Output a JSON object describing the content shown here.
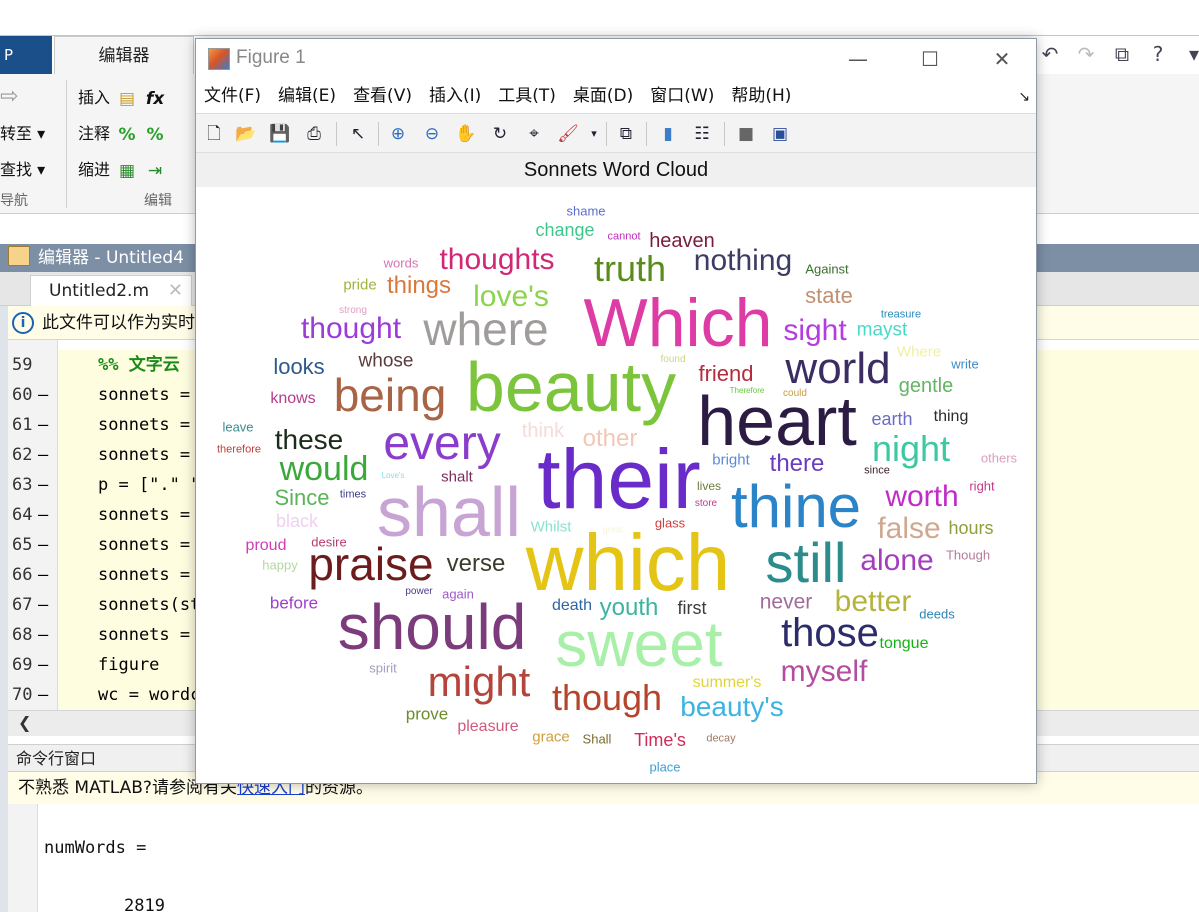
{
  "ribbon": {
    "prev_tab": "P",
    "active_tab": "编辑器",
    "insert": "插入",
    "fx": "fx",
    "goto": "转至",
    "comment": "注释",
    "comment_sym": "%",
    "find": "查找",
    "indent": "缩进",
    "group_nav": "导航",
    "group_edit": "编辑"
  },
  "editor": {
    "title": "编辑器 - Untitled4",
    "tab_label": "Untitled2.m",
    "info": "此文件可以作为实时",
    "lines": [
      {
        "num": "59",
        "dash": "",
        "text": "%% 文字云",
        "cell": true
      },
      {
        "num": "60",
        "dash": "—",
        "text": "sonnets =",
        "cell": false
      },
      {
        "num": "61",
        "dash": "—",
        "text": "sonnets =",
        "cell": false
      },
      {
        "num": "62",
        "dash": "—",
        "text": "sonnets =",
        "cell": false
      },
      {
        "num": "63",
        "dash": "—",
        "text": "p = [\".\" \"",
        "cell": false
      },
      {
        "num": "64",
        "dash": "—",
        "text": "sonnets =",
        "cell": false
      },
      {
        "num": "65",
        "dash": "—",
        "text": "sonnets =",
        "cell": false
      },
      {
        "num": "66",
        "dash": "—",
        "text": "sonnets =",
        "cell": false
      },
      {
        "num": "67",
        "dash": "—",
        "text": "sonnets(st",
        "cell": false
      },
      {
        "num": "68",
        "dash": "—",
        "text": "sonnets =",
        "cell": false
      },
      {
        "num": "69",
        "dash": "—",
        "text": "figure",
        "cell": false
      },
      {
        "num": "70",
        "dash": "—",
        "text": "wc = wordc",
        "cell": false
      }
    ]
  },
  "command": {
    "title": "命令行窗口",
    "info_prefix": "不熟悉 MATLAB?请参阅有关",
    "info_link": "快速入门",
    "info_suffix": "的资源。",
    "out_var": "numWords =",
    "out_val": "2819"
  },
  "figure": {
    "title": "Figure 1",
    "menus": [
      "文件(F)",
      "编辑(E)",
      "查看(V)",
      "插入(I)",
      "工具(T)",
      "桌面(D)",
      "窗口(W)",
      "帮助(H)"
    ],
    "chart_title": "Sonnets Word Cloud"
  },
  "chart_data": {
    "type": "wordcloud",
    "title": "Sonnets Word Cloud",
    "words": [
      {
        "text": "shame",
        "color": "#5a6fd0",
        "size": 13
      },
      {
        "text": "change",
        "color": "#3cc88c",
        "size": 18
      },
      {
        "text": "cannot",
        "color": "#c030c0",
        "size": 11
      },
      {
        "text": "heaven",
        "color": "#7a1c3c",
        "size": 20
      },
      {
        "text": "words",
        "color": "#d873b0",
        "size": 13
      },
      {
        "text": "thoughts",
        "color": "#d02874",
        "size": 30
      },
      {
        "text": "truth",
        "color": "#5a8c1c",
        "size": 36
      },
      {
        "text": "nothing",
        "color": "#3c3c64",
        "size": 30
      },
      {
        "text": "Against",
        "color": "#3a6e2e",
        "size": 13
      },
      {
        "text": "pride",
        "color": "#a0b43c",
        "size": 15
      },
      {
        "text": "things",
        "color": "#d8783c",
        "size": 24
      },
      {
        "text": "love's",
        "color": "#8cd44c",
        "size": 30
      },
      {
        "text": "state",
        "color": "#c09070",
        "size": 22
      },
      {
        "text": "strong",
        "color": "#e0a0c0",
        "size": 10
      },
      {
        "text": "treasure",
        "color": "#2c8cc0",
        "size": 11
      },
      {
        "text": "thought",
        "color": "#9c3cd8",
        "size": 30
      },
      {
        "text": "where",
        "color": "#a09c9c",
        "size": 46
      },
      {
        "text": "Which",
        "color": "#dc3ca4",
        "size": 68
      },
      {
        "text": "sight",
        "color": "#b43ce0",
        "size": 30
      },
      {
        "text": "mayst",
        "color": "#4cd8c8",
        "size": 19
      },
      {
        "text": "looks",
        "color": "#2c5a8c",
        "size": 22
      },
      {
        "text": "whose",
        "color": "#5a3c3c",
        "size": 19
      },
      {
        "text": "found",
        "color": "#c8d880",
        "size": 10
      },
      {
        "text": "Where",
        "color": "#f0f0a0",
        "size": 15
      },
      {
        "text": "write",
        "color": "#3c8cc8",
        "size": 13
      },
      {
        "text": "friend",
        "color": "#b42c3c",
        "size": 22
      },
      {
        "text": "world",
        "color": "#3c2c64",
        "size": 44
      },
      {
        "text": "being",
        "color": "#a86444",
        "size": 46
      },
      {
        "text": "beauty",
        "color": "#7cc43c",
        "size": 70
      },
      {
        "text": "gentle",
        "color": "#64b464",
        "size": 20
      },
      {
        "text": "Therefore",
        "color": "#64c83c",
        "size": 8
      },
      {
        "text": "could",
        "color": "#c89c3c",
        "size": 10
      },
      {
        "text": "knows",
        "color": "#b43c8c",
        "size": 16
      },
      {
        "text": "earth",
        "color": "#6c6cc0",
        "size": 18
      },
      {
        "text": "thing",
        "color": "#2c2c2c",
        "size": 16
      },
      {
        "text": "leave",
        "color": "#3c8c8c",
        "size": 13
      },
      {
        "text": "heart",
        "color": "#2c1c44",
        "size": 70
      },
      {
        "text": "therefore",
        "color": "#c03c3c",
        "size": 11
      },
      {
        "text": "these",
        "color": "#1c2c1c",
        "size": 28
      },
      {
        "text": "every",
        "color": "#8c3ccc",
        "size": 48
      },
      {
        "text": "think",
        "color": "#f4dcd8",
        "size": 20
      },
      {
        "text": "other",
        "color": "#f0c8b4",
        "size": 24
      },
      {
        "text": "night",
        "color": "#3cc8a0",
        "size": 36
      },
      {
        "text": "would",
        "color": "#3ca83c",
        "size": 34
      },
      {
        "text": "their",
        "color": "#6a2cc8",
        "size": 84
      },
      {
        "text": "bright",
        "color": "#5c8cd0",
        "size": 15
      },
      {
        "text": "there",
        "color": "#6c3cc0",
        "size": 24
      },
      {
        "text": "since",
        "color": "#3c1c2c",
        "size": 11
      },
      {
        "text": "others",
        "color": "#d8a0c0",
        "size": 13
      },
      {
        "text": "Love's",
        "color": "#80e0f0",
        "size": 8
      },
      {
        "text": "shalt",
        "color": "#7c2c5c",
        "size": 15
      },
      {
        "text": "lives",
        "color": "#6c7c3c",
        "size": 12
      },
      {
        "text": "right",
        "color": "#c03c8c",
        "size": 13
      },
      {
        "text": "Since",
        "color": "#5ab45a",
        "size": 22
      },
      {
        "text": "times",
        "color": "#3c3c8c",
        "size": 11
      },
      {
        "text": "shall",
        "color": "#c8a4d4",
        "size": 70
      },
      {
        "text": "thine",
        "color": "#2c84c8",
        "size": 60
      },
      {
        "text": "worth",
        "color": "#c02cc8",
        "size": 30
      },
      {
        "text": "store",
        "color": "#c03c8c",
        "size": 10
      },
      {
        "text": "black",
        "color": "#f0d0f0",
        "size": 18
      },
      {
        "text": "Whilst",
        "color": "#8ce0d0",
        "size": 15
      },
      {
        "text": "great",
        "color": "#f4f4e0",
        "size": 9
      },
      {
        "text": "glass",
        "color": "#d03c3c",
        "size": 13
      },
      {
        "text": "false",
        "color": "#d0a890",
        "size": 30
      },
      {
        "text": "hours",
        "color": "#8ca03c",
        "size": 18
      },
      {
        "text": "proud",
        "color": "#d03cb4",
        "size": 16
      },
      {
        "text": "desire",
        "color": "#b43c6c",
        "size": 13
      },
      {
        "text": "praise",
        "color": "#6c1c1c",
        "size": 46
      },
      {
        "text": "verse",
        "color": "#3c3c2c",
        "size": 24
      },
      {
        "text": "which",
        "color": "#e4c414",
        "size": 80
      },
      {
        "text": "still",
        "color": "#2c8c8c",
        "size": 56
      },
      {
        "text": "alone",
        "color": "#a43cc0",
        "size": 30
      },
      {
        "text": "Though",
        "color": "#b47c9c",
        "size": 13
      },
      {
        "text": "happy",
        "color": "#b4d8a0",
        "size": 13
      },
      {
        "text": "power",
        "color": "#4c3c8c",
        "size": 10
      },
      {
        "text": "again",
        "color": "#a05ac8",
        "size": 13
      },
      {
        "text": "before",
        "color": "#a03cd0",
        "size": 17
      },
      {
        "text": "should",
        "color": "#7c3c7c",
        "size": 64
      },
      {
        "text": "death",
        "color": "#2c64a8",
        "size": 16
      },
      {
        "text": "youth",
        "color": "#3cb4a0",
        "size": 24
      },
      {
        "text": "first",
        "color": "#3c3c3c",
        "size": 18
      },
      {
        "text": "never",
        "color": "#a06c9c",
        "size": 21
      },
      {
        "text": "better",
        "color": "#b4b43c",
        "size": 30
      },
      {
        "text": "deeds",
        "color": "#2c84b4",
        "size": 13
      },
      {
        "text": "sweet",
        "color": "#a8f0a8",
        "size": 64
      },
      {
        "text": "those",
        "color": "#2c2c6c",
        "size": 40
      },
      {
        "text": "tongue",
        "color": "#14b414",
        "size": 16
      },
      {
        "text": "spirit",
        "color": "#a0a0c0",
        "size": 13
      },
      {
        "text": "myself",
        "color": "#b44ca0",
        "size": 30
      },
      {
        "text": "might",
        "color": "#b4443c",
        "size": 42
      },
      {
        "text": "summer's",
        "color": "#e0d43c",
        "size": 16
      },
      {
        "text": "though",
        "color": "#b4442c",
        "size": 36
      },
      {
        "text": "beauty's",
        "color": "#3cb4e0",
        "size": 28
      },
      {
        "text": "prove",
        "color": "#6c8c2c",
        "size": 17
      },
      {
        "text": "pleasure",
        "color": "#d05a7c",
        "size": 16
      },
      {
        "text": "grace",
        "color": "#d0a03c",
        "size": 15
      },
      {
        "text": "Shall",
        "color": "#7c6c2c",
        "size": 13
      },
      {
        "text": "Time's",
        "color": "#d02c5c",
        "size": 18
      },
      {
        "text": "decay",
        "color": "#a07c6c",
        "size": 11
      },
      {
        "text": "place",
        "color": "#3ca0d8",
        "size": 13
      }
    ]
  }
}
